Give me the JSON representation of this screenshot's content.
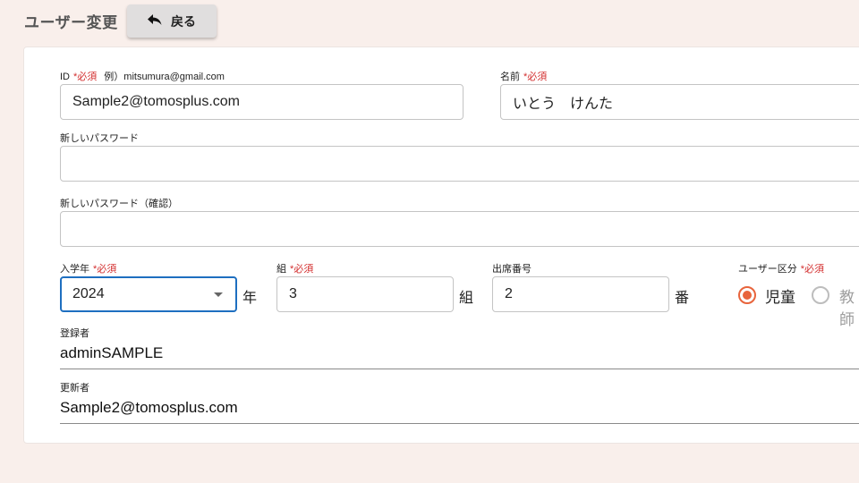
{
  "header": {
    "title": "ユーザー変更",
    "back_label": "戻る"
  },
  "form": {
    "required_mark": "*必須",
    "id": {
      "label": "ID",
      "hint": "例）mitsumura@gmail.com",
      "value": "Sample2@tomosplus.com"
    },
    "name": {
      "label": "名前",
      "value": "いとう　けんた"
    },
    "new_password": {
      "label": "新しいパスワード",
      "value": ""
    },
    "new_password_confirm": {
      "label": "新しいパスワード（確認）",
      "value": ""
    },
    "enrollment_year": {
      "label": "入学年",
      "value": "2024",
      "unit": "年"
    },
    "class_group": {
      "label": "組",
      "value": "3",
      "unit": "組"
    },
    "attendance_number": {
      "label": "出席番号",
      "value": "2",
      "unit": "番"
    },
    "user_type": {
      "label": "ユーザー区分",
      "options": [
        {
          "label": "児童",
          "selected": true
        },
        {
          "label": "教師",
          "selected": false
        }
      ]
    },
    "registered_by": {
      "label": "登録者",
      "value": "adminSAMPLE"
    },
    "updated_by": {
      "label": "更新者",
      "value": "Sample2@tomosplus.com"
    }
  },
  "colors": {
    "background": "#f9efeb",
    "required": "#d32f2f",
    "focus": "#1e6fc0",
    "radio_accent": "#e8643c"
  },
  "icons": {
    "back": "reply-arrow-icon",
    "select": "caret-down-icon"
  }
}
